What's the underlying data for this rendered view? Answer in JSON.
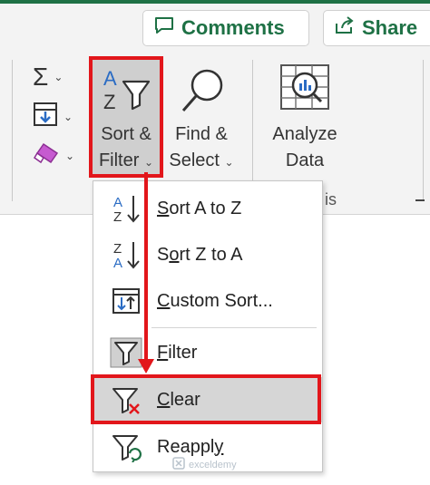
{
  "header": {
    "comments_label": "Comments",
    "share_label": "Share"
  },
  "ribbon": {
    "sort_filter_label_line1": "Sort &",
    "sort_filter_label_line2": "Filter",
    "find_select_label_line1": "Find &",
    "find_select_label_line2": "Select",
    "analyze_label_line1": "Analyze",
    "analyze_label_line2": "Data",
    "group_fragment": "is",
    "dropdown_chevron": "⌄"
  },
  "menu": {
    "items": [
      {
        "pre": "",
        "u": "S",
        "post": "ort A to Z"
      },
      {
        "pre": "S",
        "u": "o",
        "post": "rt Z to A"
      },
      {
        "pre": "",
        "u": "C",
        "post": "ustom Sort..."
      },
      {
        "pre": "",
        "u": "F",
        "post": "ilter"
      },
      {
        "pre": "",
        "u": "C",
        "post": "lear"
      },
      {
        "pre": "Reappl",
        "u": "y",
        "post": ""
      }
    ]
  },
  "watermark": {
    "text": "exceldemy"
  },
  "colors": {
    "accent_green": "#1e7145",
    "highlight_red": "#e2161b",
    "icon_blue": "#2b6cc4",
    "eraser_purple": "#b24ab8"
  }
}
